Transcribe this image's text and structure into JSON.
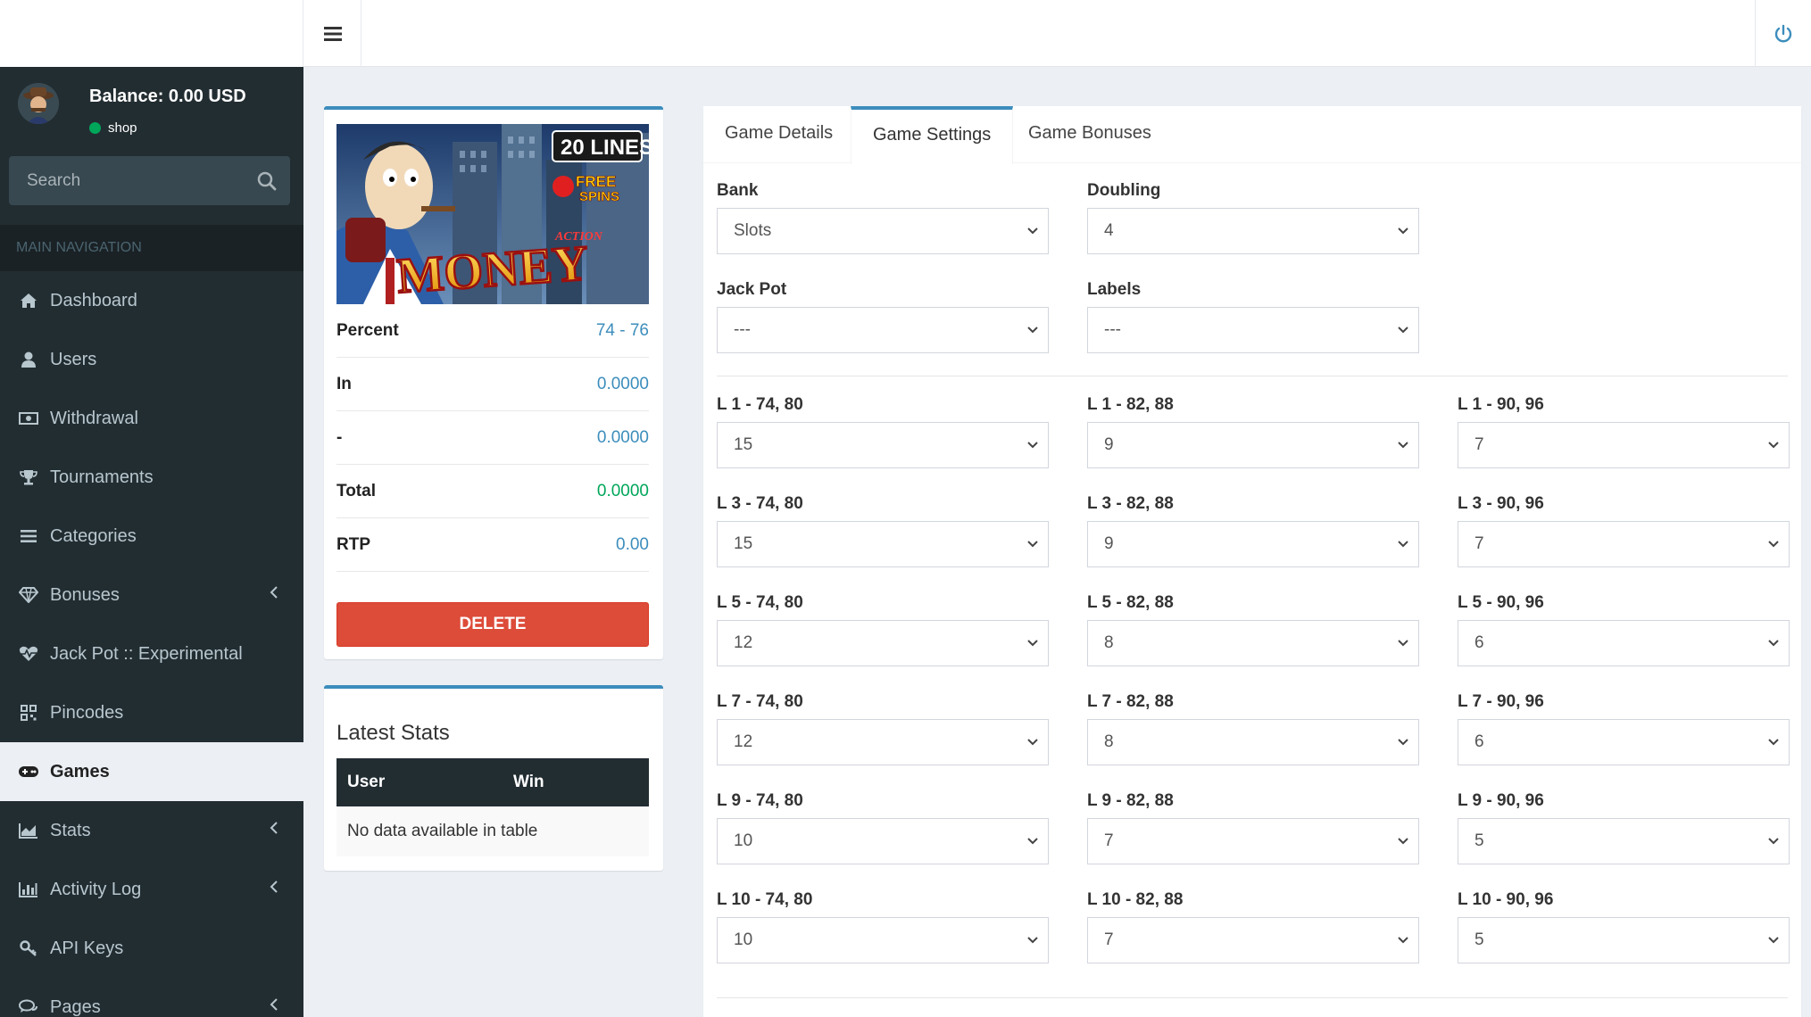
{
  "sidebar": {
    "balance": "Balance: 0.00 USD",
    "status": "shop",
    "search_placeholder": "Search",
    "nav_header": "MAIN NAVIGATION",
    "items": [
      {
        "label": "Dashboard",
        "icon": "home-icon"
      },
      {
        "label": "Users",
        "icon": "user-icon"
      },
      {
        "label": "Withdrawal",
        "icon": "money-icon"
      },
      {
        "label": "Tournaments",
        "icon": "trophy-icon"
      },
      {
        "label": "Categories",
        "icon": "list-icon"
      },
      {
        "label": "Bonuses",
        "icon": "diamond-icon"
      },
      {
        "label": "Jack Pot :: Experimental",
        "icon": "heartbeat-icon"
      },
      {
        "label": "Pincodes",
        "icon": "qrcode-icon"
      },
      {
        "label": "Games",
        "icon": "gamepad-icon"
      },
      {
        "label": "Stats",
        "icon": "area-chart-icon"
      },
      {
        "label": "Activity Log",
        "icon": "bar-chart-icon"
      },
      {
        "label": "API Keys",
        "icon": "key-icon"
      },
      {
        "label": "Pages",
        "icon": "comments-icon"
      }
    ],
    "active": "Games"
  },
  "game": {
    "image_texts": {
      "lines": "20 LINES",
      "free": "FREE",
      "spins": "SPINS",
      "action": "ACTION",
      "title": "MONEY"
    },
    "stats": [
      {
        "label": "Percent",
        "value": "74 - 76"
      },
      {
        "label": "In",
        "value": "0.0000"
      },
      {
        "label": "-",
        "value": "0.0000"
      },
      {
        "label": "Total",
        "value": "0.0000"
      },
      {
        "label": "RTP",
        "value": "0.00"
      }
    ],
    "delete_label": "DELETE"
  },
  "latest_stats": {
    "title": "Latest Stats",
    "columns": [
      "User",
      "Win"
    ],
    "empty": "No data available in table"
  },
  "tabs": [
    "Game Details",
    "Game Settings",
    "Game Bonuses"
  ],
  "active_tab": "Game Settings",
  "settings": {
    "bank": {
      "label": "Bank",
      "value": "Slots"
    },
    "doubling": {
      "label": "Doubling",
      "value": "4"
    },
    "jackpot": {
      "label": "Jack Pot",
      "value": "---"
    },
    "labels": {
      "label": "Labels",
      "value": "---"
    },
    "grid": [
      [
        {
          "label": "L 1 - 74, 80",
          "value": "15"
        },
        {
          "label": "L 1 - 82, 88",
          "value": "9"
        },
        {
          "label": "L 1 - 90, 96",
          "value": "7"
        }
      ],
      [
        {
          "label": "L 3 - 74, 80",
          "value": "15"
        },
        {
          "label": "L 3 - 82, 88",
          "value": "9"
        },
        {
          "label": "L 3 - 90, 96",
          "value": "7"
        }
      ],
      [
        {
          "label": "L 5 - 74, 80",
          "value": "12"
        },
        {
          "label": "L 5 - 82, 88",
          "value": "8"
        },
        {
          "label": "L 5 - 90, 96",
          "value": "6"
        }
      ],
      [
        {
          "label": "L 7 - 74, 80",
          "value": "12"
        },
        {
          "label": "L 7 - 82, 88",
          "value": "8"
        },
        {
          "label": "L 7 - 90, 96",
          "value": "6"
        }
      ],
      [
        {
          "label": "L 9 - 74, 80",
          "value": "10"
        },
        {
          "label": "L 9 - 82, 88",
          "value": "7"
        },
        {
          "label": "L 9 - 90, 96",
          "value": "5"
        }
      ],
      [
        {
          "label": "L 10 - 74, 80",
          "value": "10"
        },
        {
          "label": "L 10 - 82, 88",
          "value": "7"
        },
        {
          "label": "L 10 - 90, 96",
          "value": "5"
        }
      ]
    ]
  },
  "colors": {
    "sidebar_bg": "#222d32",
    "accent": "#3c8dbc",
    "danger": "#dd4b39",
    "success": "#00a65a"
  }
}
